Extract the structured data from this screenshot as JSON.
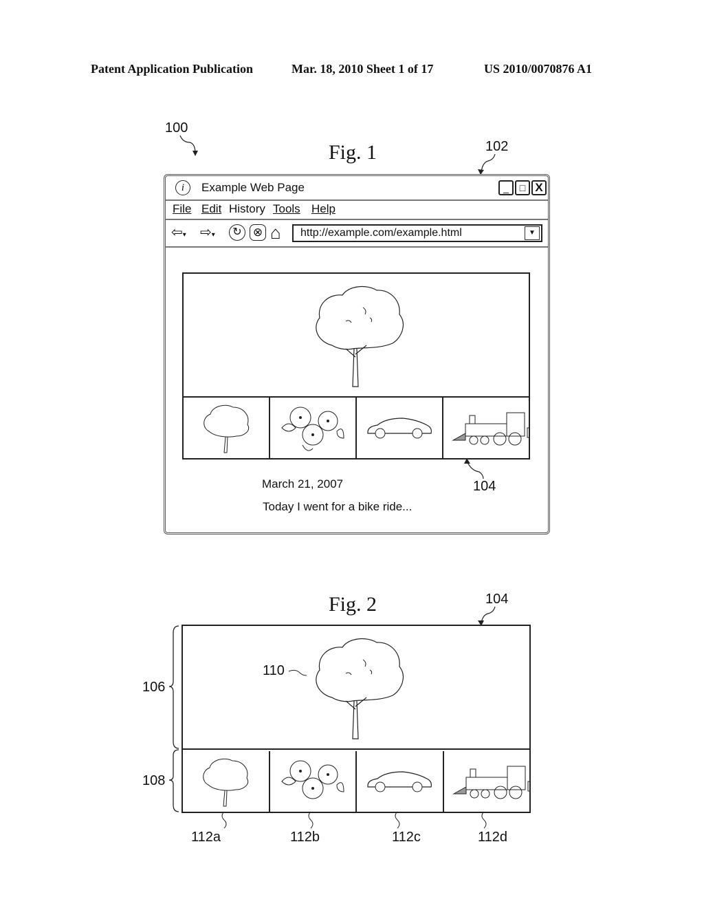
{
  "header": {
    "publication": "Patent Application Publication",
    "date_sheet": "Mar. 18, 2010  Sheet 1 of 17",
    "number": "US 2010/0070876 A1"
  },
  "fig1": {
    "title": "Fig. 1",
    "ref_system": "100",
    "ref_window": "102",
    "ref_gallery": "104",
    "window": {
      "info_icon": "i",
      "title": "Example Web Page",
      "buttons": {
        "minimize": "_",
        "maximize": "□",
        "close": "X"
      },
      "menu": [
        {
          "label": "File"
        },
        {
          "label": "Edit"
        },
        {
          "label": "History"
        },
        {
          "label": "Tools"
        },
        {
          "label": "Help"
        }
      ],
      "toolbar": {
        "back": "⇦",
        "forward": "⇨",
        "dropdown": "▾",
        "refresh": "↻",
        "stop": "⊗",
        "home": "⌂",
        "url": "http://example.com/example.html",
        "url_dropdown": "▼"
      },
      "post": {
        "date": "March 21, 2007",
        "text": "Today I went for a bike ride..."
      }
    },
    "thumbnails": [
      "tree",
      "flowers",
      "car",
      "train"
    ]
  },
  "fig2": {
    "title": "Fig. 2",
    "ref_gallery": "104",
    "ref_main_region": "106",
    "ref_thumb_region": "108",
    "ref_main_image": "110",
    "thumb_refs": [
      "112a",
      "112b",
      "112c",
      "112d"
    ]
  }
}
